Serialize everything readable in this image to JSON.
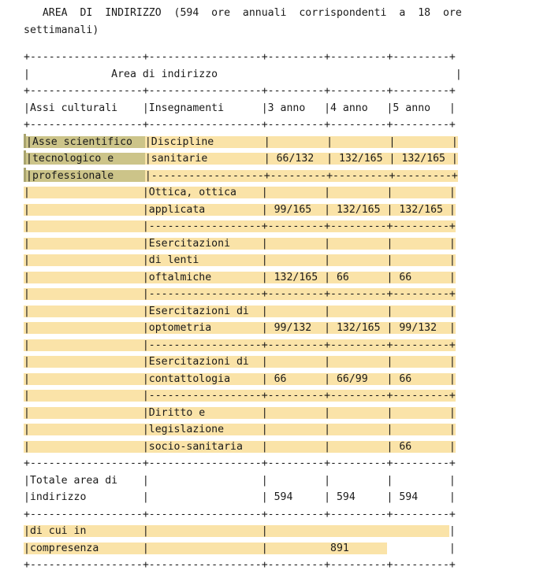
{
  "document": {
    "title": "AREA DI INDIRIZZO",
    "heading_lines": [
      "   AREA  DI  INDIRIZZO  (594  ore  annuali  corrispondenti  a  18  ore",
      "settimanali)"
    ],
    "heading_text": "AREA DI INDIRIZZO (594 ore annuali corrispondenti a 18 ore settimanali)",
    "annual_hours": "594",
    "weekly_hours": "18"
  },
  "colors": {
    "page_background": "#ffffff",
    "text": "#1a1a1a",
    "body_highlight": "#fae3a8",
    "selection_highlight": "#ccc489",
    "rule": "#1a1a1a"
  },
  "table": {
    "caption": "Area di indirizzo",
    "column_headers": [
      "Assi culturali",
      "Insegnamenti",
      "3 anno",
      "4 anno",
      "5 anno"
    ],
    "axis_group_label": "Asse scientifico tecnologico e professionale",
    "axis_group_lines": [
      "Asse scientifico",
      "tecnologico e",
      "professionale"
    ],
    "subjects": [
      {
        "name": "Discipline sanitarie",
        "lines": [
          "Discipline",
          "sanitarie"
        ],
        "anno3": "66/132",
        "anno4": "132/165",
        "anno5": "132/165"
      },
      {
        "name": "Ottica, ottica applicata",
        "lines": [
          "Ottica, ottica",
          "applicata"
        ],
        "anno3": "99/165",
        "anno4": "132/165",
        "anno5": "132/165"
      },
      {
        "name": "Esercitazioni di lenti oftalmiche",
        "lines": [
          "Esercitazioni",
          "di lenti",
          "oftalmiche"
        ],
        "anno3": "132/165",
        "anno4": "66",
        "anno5": "66"
      },
      {
        "name": "Esercitazioni di optometria",
        "lines": [
          "Esercitazioni di",
          "optometria"
        ],
        "anno3": "99/132",
        "anno4": "132/165",
        "anno5": "99/132"
      },
      {
        "name": "Esercitazioni di contattologia",
        "lines": [
          "Esercitazioni di",
          "contattologia"
        ],
        "anno3": "66",
        "anno4": "66/99",
        "anno5": "66"
      },
      {
        "name": "Diritto e legislazione socio-sanitaria",
        "lines": [
          "Diritto e",
          "legislazione",
          "socio-sanitaria"
        ],
        "anno3": "",
        "anno4": "",
        "anno5": "66"
      }
    ],
    "totals": {
      "label": "Totale area di indirizzo",
      "label_lines": [
        "Totale area di",
        "indirizzo"
      ],
      "anno3": "594",
      "anno4": "594",
      "anno5": "594"
    },
    "compresenza": {
      "label": "di cui in compresenza",
      "label_lines": [
        "di cui in",
        "compresenza"
      ],
      "value": "891"
    }
  },
  "ascii_rows": [
    {
      "id": "rule-top",
      "kind": "rule",
      "segments": [
        {
          "t": "+------------------+------------------+---------+---------+---------+",
          "h": "none"
        }
      ]
    },
    {
      "id": "caption-blank",
      "kind": "text",
      "segments": [
        {
          "t": "|             Area di indirizzo                                      |",
          "h": "none"
        }
      ]
    },
    {
      "id": "rule-caption",
      "kind": "rule",
      "segments": [
        {
          "t": "+------------------+------------------+---------+---------+---------+",
          "h": "none"
        }
      ]
    },
    {
      "id": "header",
      "kind": "header",
      "segments": [
        {
          "t": "|Assi culturali    |Insegnamenti      |3 anno   |4 anno   |5 anno   |",
          "h": "none"
        }
      ]
    },
    {
      "id": "rule-header",
      "kind": "rule",
      "segments": [
        {
          "t": "+------------------+------------------+---------+---------+---------+",
          "h": "none"
        }
      ]
    },
    {
      "id": "r1a",
      "kind": "data",
      "caret": true,
      "segments": [
        {
          "t": "|Asse scientifico  ",
          "h": "sel"
        },
        {
          "t": "|Discipline        |         |         |         |",
          "h": "body"
        }
      ]
    },
    {
      "id": "r1b",
      "kind": "data",
      "caret": true,
      "segments": [
        {
          "t": "|tecnologico e     ",
          "h": "sel"
        },
        {
          "t": "|sanitarie         | 66/132  | 132/165 | 132/165 |",
          "h": "body"
        }
      ]
    },
    {
      "id": "r1c",
      "kind": "data",
      "caret": true,
      "segments": [
        {
          "t": "|professionale     ",
          "h": "sel"
        },
        {
          "t": "|------------------+---------+---------+---------+",
          "h": "body"
        }
      ]
    },
    {
      "id": "r2a",
      "kind": "data",
      "segments": [
        {
          "t": "|                  |Ottica, ottica    |         |         |         |",
          "h": "body"
        }
      ]
    },
    {
      "id": "r2b",
      "kind": "data",
      "segments": [
        {
          "t": "|                  |applicata         | 99/165  | 132/165 | 132/165 |",
          "h": "body"
        }
      ]
    },
    {
      "id": "r2c",
      "kind": "data",
      "segments": [
        {
          "t": "|                  |------------------+---------+---------+---------+",
          "h": "body"
        }
      ]
    },
    {
      "id": "r3a",
      "kind": "data",
      "segments": [
        {
          "t": "|                  |Esercitazioni     |         |         |         |",
          "h": "body"
        }
      ]
    },
    {
      "id": "r3b",
      "kind": "data",
      "segments": [
        {
          "t": "|                  |di lenti          |         |         |         |",
          "h": "body"
        }
      ]
    },
    {
      "id": "r3c",
      "kind": "data",
      "segments": [
        {
          "t": "|                  |oftalmiche        | 132/165 | 66      | 66      |",
          "h": "body"
        }
      ]
    },
    {
      "id": "r3d",
      "kind": "data",
      "segments": [
        {
          "t": "|                  |------------------+---------+---------+---------+",
          "h": "body"
        }
      ]
    },
    {
      "id": "r4a",
      "kind": "data",
      "segments": [
        {
          "t": "|                  |Esercitazioni di  |         |         |         |",
          "h": "body"
        }
      ]
    },
    {
      "id": "r4b",
      "kind": "data",
      "segments": [
        {
          "t": "|                  |optometria        | 99/132  | 132/165 | 99/132  |",
          "h": "body"
        }
      ]
    },
    {
      "id": "r4c",
      "kind": "data",
      "segments": [
        {
          "t": "|                  |------------------+---------+---------+---------+",
          "h": "body"
        }
      ]
    },
    {
      "id": "r5a",
      "kind": "data",
      "segments": [
        {
          "t": "|                  |Esercitazioni di  |         |         |         |",
          "h": "body"
        }
      ]
    },
    {
      "id": "r5b",
      "kind": "data",
      "segments": [
        {
          "t": "|                  |contattologia     | 66      | 66/99   | 66      |",
          "h": "body"
        }
      ]
    },
    {
      "id": "r5c",
      "kind": "data",
      "segments": [
        {
          "t": "|                  |------------------+---------+---------+---------+",
          "h": "body"
        }
      ]
    },
    {
      "id": "r6a",
      "kind": "data",
      "segments": [
        {
          "t": "|                  |Diritto e         |         |         |         |",
          "h": "body"
        }
      ]
    },
    {
      "id": "r6b",
      "kind": "data",
      "segments": [
        {
          "t": "|                  |legislazione      |         |         |         |",
          "h": "body"
        }
      ]
    },
    {
      "id": "r6c",
      "kind": "data",
      "segments": [
        {
          "t": "|                  |socio-sanitaria   |         |         | 66      |",
          "h": "body"
        }
      ]
    },
    {
      "id": "rule-totals",
      "kind": "rule",
      "segments": [
        {
          "t": "+------------------+------------------+---------+---------+---------+",
          "h": "none"
        }
      ]
    },
    {
      "id": "t1",
      "kind": "total",
      "segments": [
        {
          "t": "|Totale area di    |                  |         |         |         |",
          "h": "none"
        }
      ]
    },
    {
      "id": "t2",
      "kind": "total",
      "segments": [
        {
          "t": "|indirizzo         |                  | 594     | 594     | 594     |",
          "h": "none"
        }
      ]
    },
    {
      "id": "rule-compresenza",
      "kind": "rule",
      "segments": [
        {
          "t": "+------------------+------------------+---------+---------+---------+",
          "h": "none"
        }
      ]
    },
    {
      "id": "c1",
      "kind": "compresenza",
      "segments": [
        {
          "t": "|di cui in         |                  |                             ",
          "h": "body"
        },
        {
          "t": "|",
          "h": "none"
        }
      ]
    },
    {
      "id": "c2",
      "kind": "compresenza",
      "segments": [
        {
          "t": "|compresenza       |                  |          891      ",
          "h": "body"
        },
        {
          "t": "          |",
          "h": "none"
        }
      ]
    },
    {
      "id": "rule-bottom",
      "kind": "rule",
      "segments": [
        {
          "t": "+------------------+------------------+---------+---------+---------+",
          "h": "none"
        }
      ]
    }
  ]
}
